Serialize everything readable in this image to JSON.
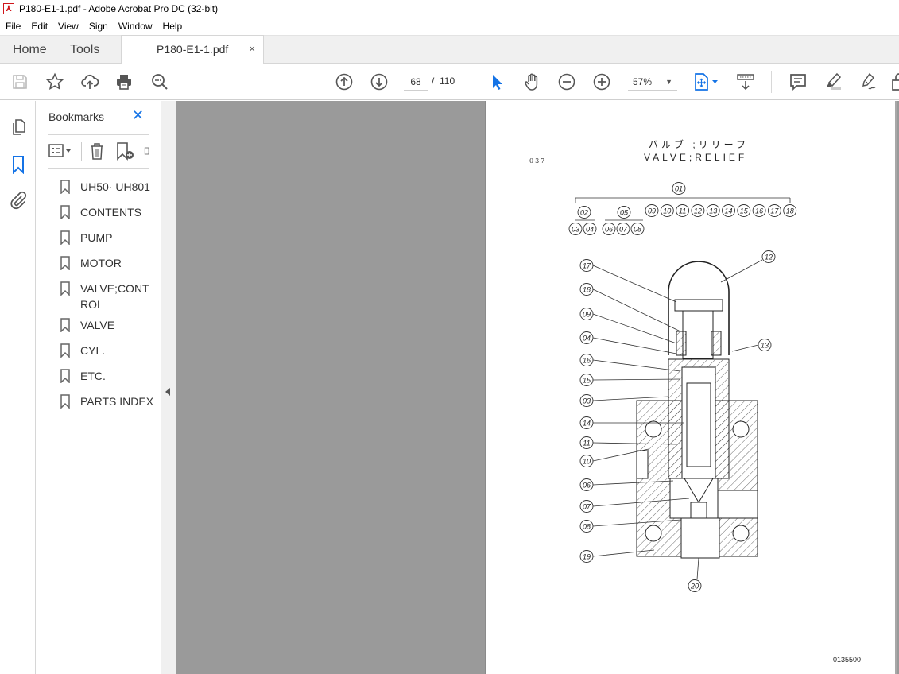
{
  "window": {
    "title": "P180-E1-1.pdf - Adobe Acrobat Pro DC (32-bit)",
    "app_icon": "acrobat-pdf-icon"
  },
  "menubar": {
    "items": [
      "File",
      "Edit",
      "View",
      "Sign",
      "Window",
      "Help"
    ]
  },
  "tabs": {
    "home": "Home",
    "tools": "Tools",
    "document": "P180-E1-1.pdf",
    "close": "×"
  },
  "toolbar": {
    "left_icons": [
      "save-icon",
      "star-icon",
      "upload-cloud-icon",
      "print-icon",
      "search-zoom-icon"
    ],
    "page_current": "68",
    "page_separator": "/",
    "page_total": "110",
    "zoom_level": "57%",
    "zoom_caret": "▼",
    "right_icons": [
      "select-arrow-icon",
      "hand-icon",
      "zoom-out-icon",
      "zoom-in-icon",
      "fit-page-icon",
      "scroll-mode-icon",
      "comment-icon",
      "highlight-icon",
      "sign-icon",
      "lock-icon"
    ]
  },
  "left_rail": {
    "icons": [
      "pages-icon",
      "bookmark-icon",
      "attachment-icon"
    ]
  },
  "bookmarks": {
    "title": "Bookmarks",
    "close": "✕",
    "tools": [
      "options-menu-icon",
      "delete-icon",
      "new-bookmark-icon",
      "expand-icon"
    ],
    "items": [
      {
        "label": "UH50· UH801"
      },
      {
        "label": "CONTENTS"
      },
      {
        "label": "PUMP"
      },
      {
        "label": "MOTOR"
      },
      {
        "label": "VALVE;CONTROL"
      },
      {
        "label": "VALVE"
      },
      {
        "label": "CYL."
      },
      {
        "label": "ETC."
      },
      {
        "label": "PARTS INDEX"
      }
    ]
  },
  "page": {
    "code": "037",
    "title_jp": "バルブ ;リリーフ",
    "title_en": "VALVE;RELIEF",
    "drawing_number": "0135500",
    "tree": {
      "root": "01",
      "group_a": {
        "parent": "02",
        "children": [
          "03",
          "04"
        ]
      },
      "group_b": {
        "parent": "05",
        "children": [
          "06",
          "07",
          "08"
        ]
      },
      "singles": [
        "09",
        "10",
        "11",
        "12",
        "13",
        "14",
        "15",
        "16",
        "17",
        "18"
      ]
    },
    "callouts_left": [
      "17",
      "18",
      "09",
      "04",
      "16",
      "15",
      "03",
      "14",
      "11",
      "10",
      "06",
      "07",
      "08",
      "19"
    ],
    "callouts_right": [
      "12",
      "13"
    ],
    "callout_bottom": "20"
  }
}
